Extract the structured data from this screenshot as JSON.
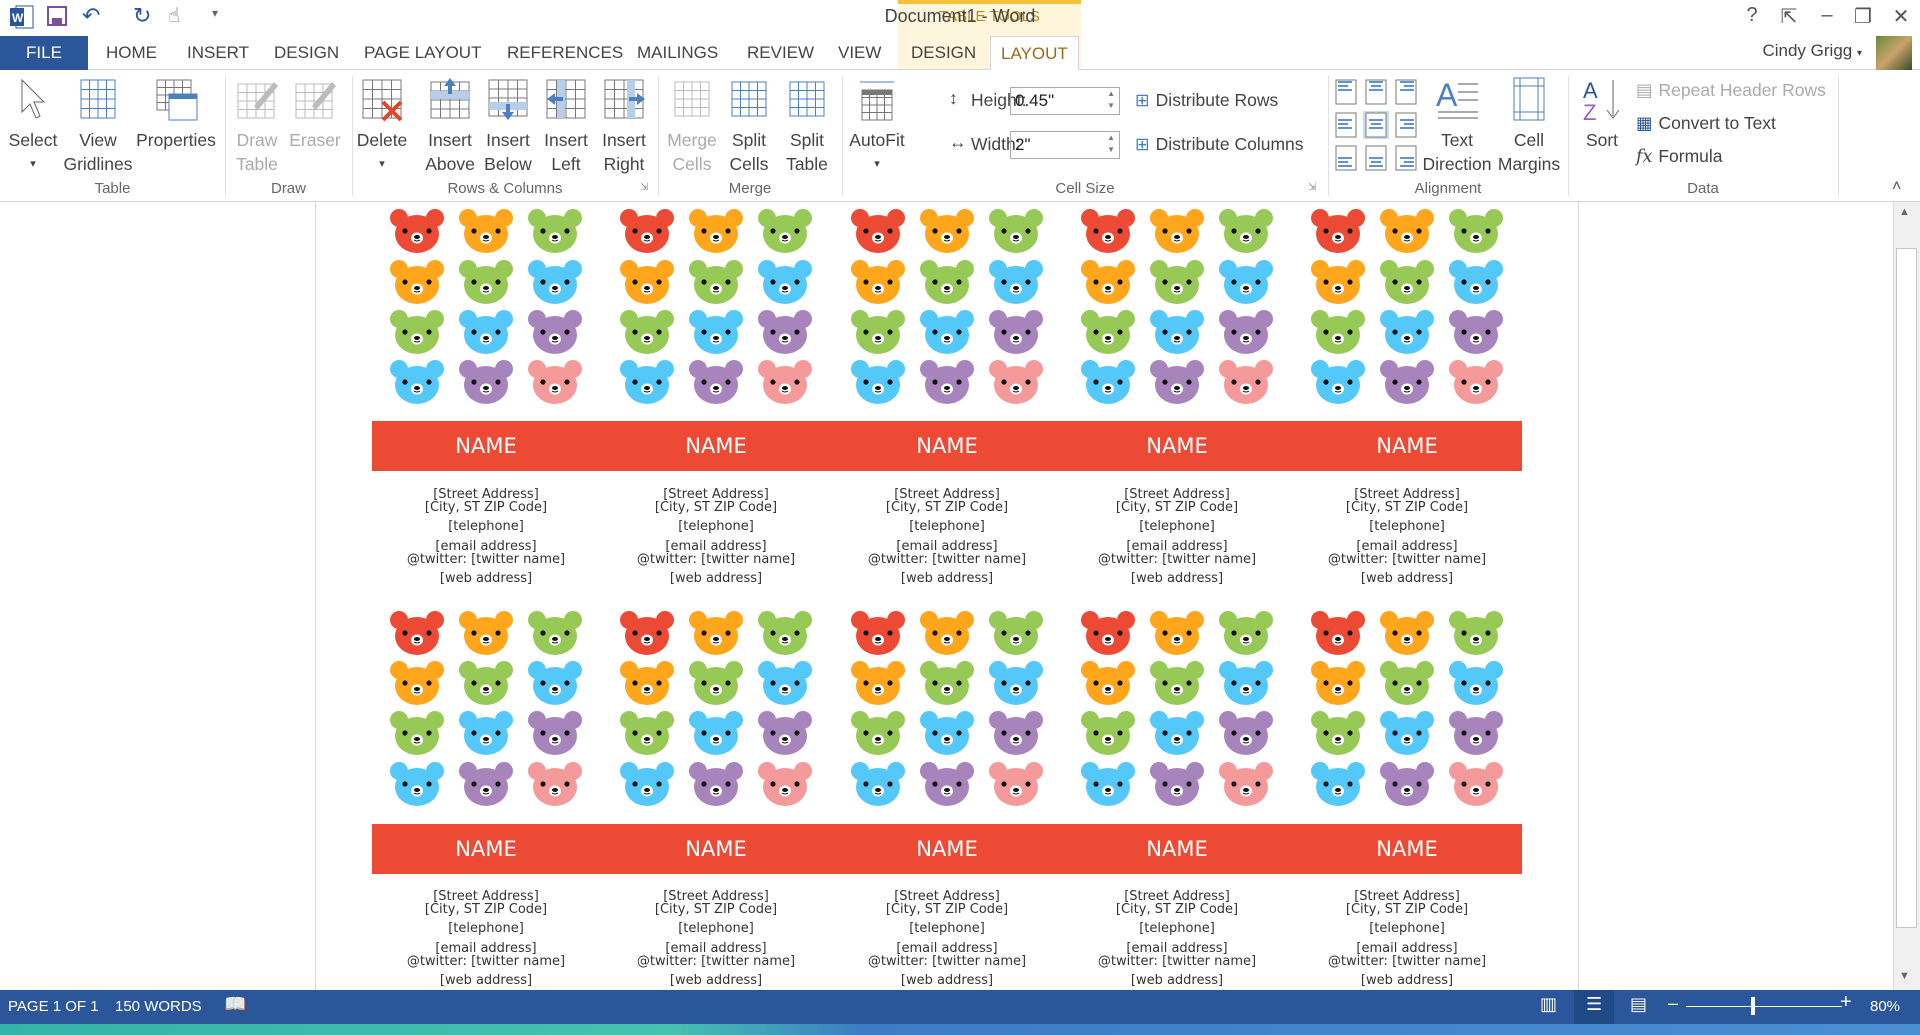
{
  "window": {
    "title": "Document1 - Word",
    "context_tab_group": "TABLE TOOLS",
    "user": "Cindy Grigg"
  },
  "tabs": [
    {
      "label": "FILE"
    },
    {
      "label": "HOME"
    },
    {
      "label": "INSERT"
    },
    {
      "label": "DESIGN"
    },
    {
      "label": "PAGE LAYOUT"
    },
    {
      "label": "REFERENCES"
    },
    {
      "label": "MAILINGS"
    },
    {
      "label": "REVIEW"
    },
    {
      "label": "VIEW"
    },
    {
      "label": "DESIGN"
    },
    {
      "label": "LAYOUT"
    }
  ],
  "active_tab": "LAYOUT",
  "ribbon": {
    "groups": {
      "table": "Table",
      "draw": "Draw",
      "rows_columns": "Rows & Columns",
      "merge": "Merge",
      "cell_size": "Cell Size",
      "alignment": "Alignment",
      "data": "Data"
    },
    "select": [
      "Select",
      "▾"
    ],
    "view_gridlines": [
      "View",
      "Gridlines"
    ],
    "properties": [
      "Properties",
      ""
    ],
    "draw_table": [
      "Draw",
      "Table"
    ],
    "eraser": [
      "Eraser",
      ""
    ],
    "delete": [
      "Delete",
      "▾"
    ],
    "insert_above": [
      "Insert",
      "Above"
    ],
    "insert_below": [
      "Insert",
      "Below"
    ],
    "insert_left": [
      "Insert",
      "Left"
    ],
    "insert_right": [
      "Insert",
      "Right"
    ],
    "merge_cells": [
      "Merge",
      "Cells"
    ],
    "split_cells": [
      "Split",
      "Cells"
    ],
    "split_table": [
      "Split",
      "Table"
    ],
    "autofit": [
      "AutoFit",
      "▾"
    ],
    "height_label": "Height:",
    "height_value": "0.45\"",
    "width_label": "Width:",
    "width_value": "2\"",
    "distribute_rows": "Distribute Rows",
    "distribute_columns": "Distribute Columns",
    "text_direction": [
      "Text",
      "Direction"
    ],
    "cell_margins": [
      "Cell",
      "Margins"
    ],
    "sort": "Sort",
    "repeat_header_rows": "Repeat Header Rows",
    "convert_to_text": "Convert to Text",
    "formula": "Formula"
  },
  "document": {
    "colors": {
      "band": "#ec4a34",
      "red": "#ec4a34",
      "orange": "#ffa61c",
      "green": "#97c957",
      "blue": "#54c8f8",
      "purple": "#a884bc",
      "pink": "#f59a9a"
    },
    "bear_pattern": [
      [
        "red",
        "orange",
        "green"
      ],
      [
        "orange",
        "green",
        "blue"
      ],
      [
        "green",
        "blue",
        "purple"
      ],
      [
        "blue",
        "purple",
        "pink"
      ]
    ],
    "label": {
      "name": "NAME",
      "street": "[Street Address]",
      "city": "[City, ST  ZIP Code]",
      "telephone": "[telephone]",
      "email": "[email address]",
      "twitter": "@twitter: [twitter name]",
      "web": "[web address]"
    },
    "columns": 5,
    "rows": 2
  },
  "status": {
    "page": "PAGE 1 OF 1",
    "words": "150 WORDS",
    "zoom": "80%",
    "zoom_percent": 80
  }
}
